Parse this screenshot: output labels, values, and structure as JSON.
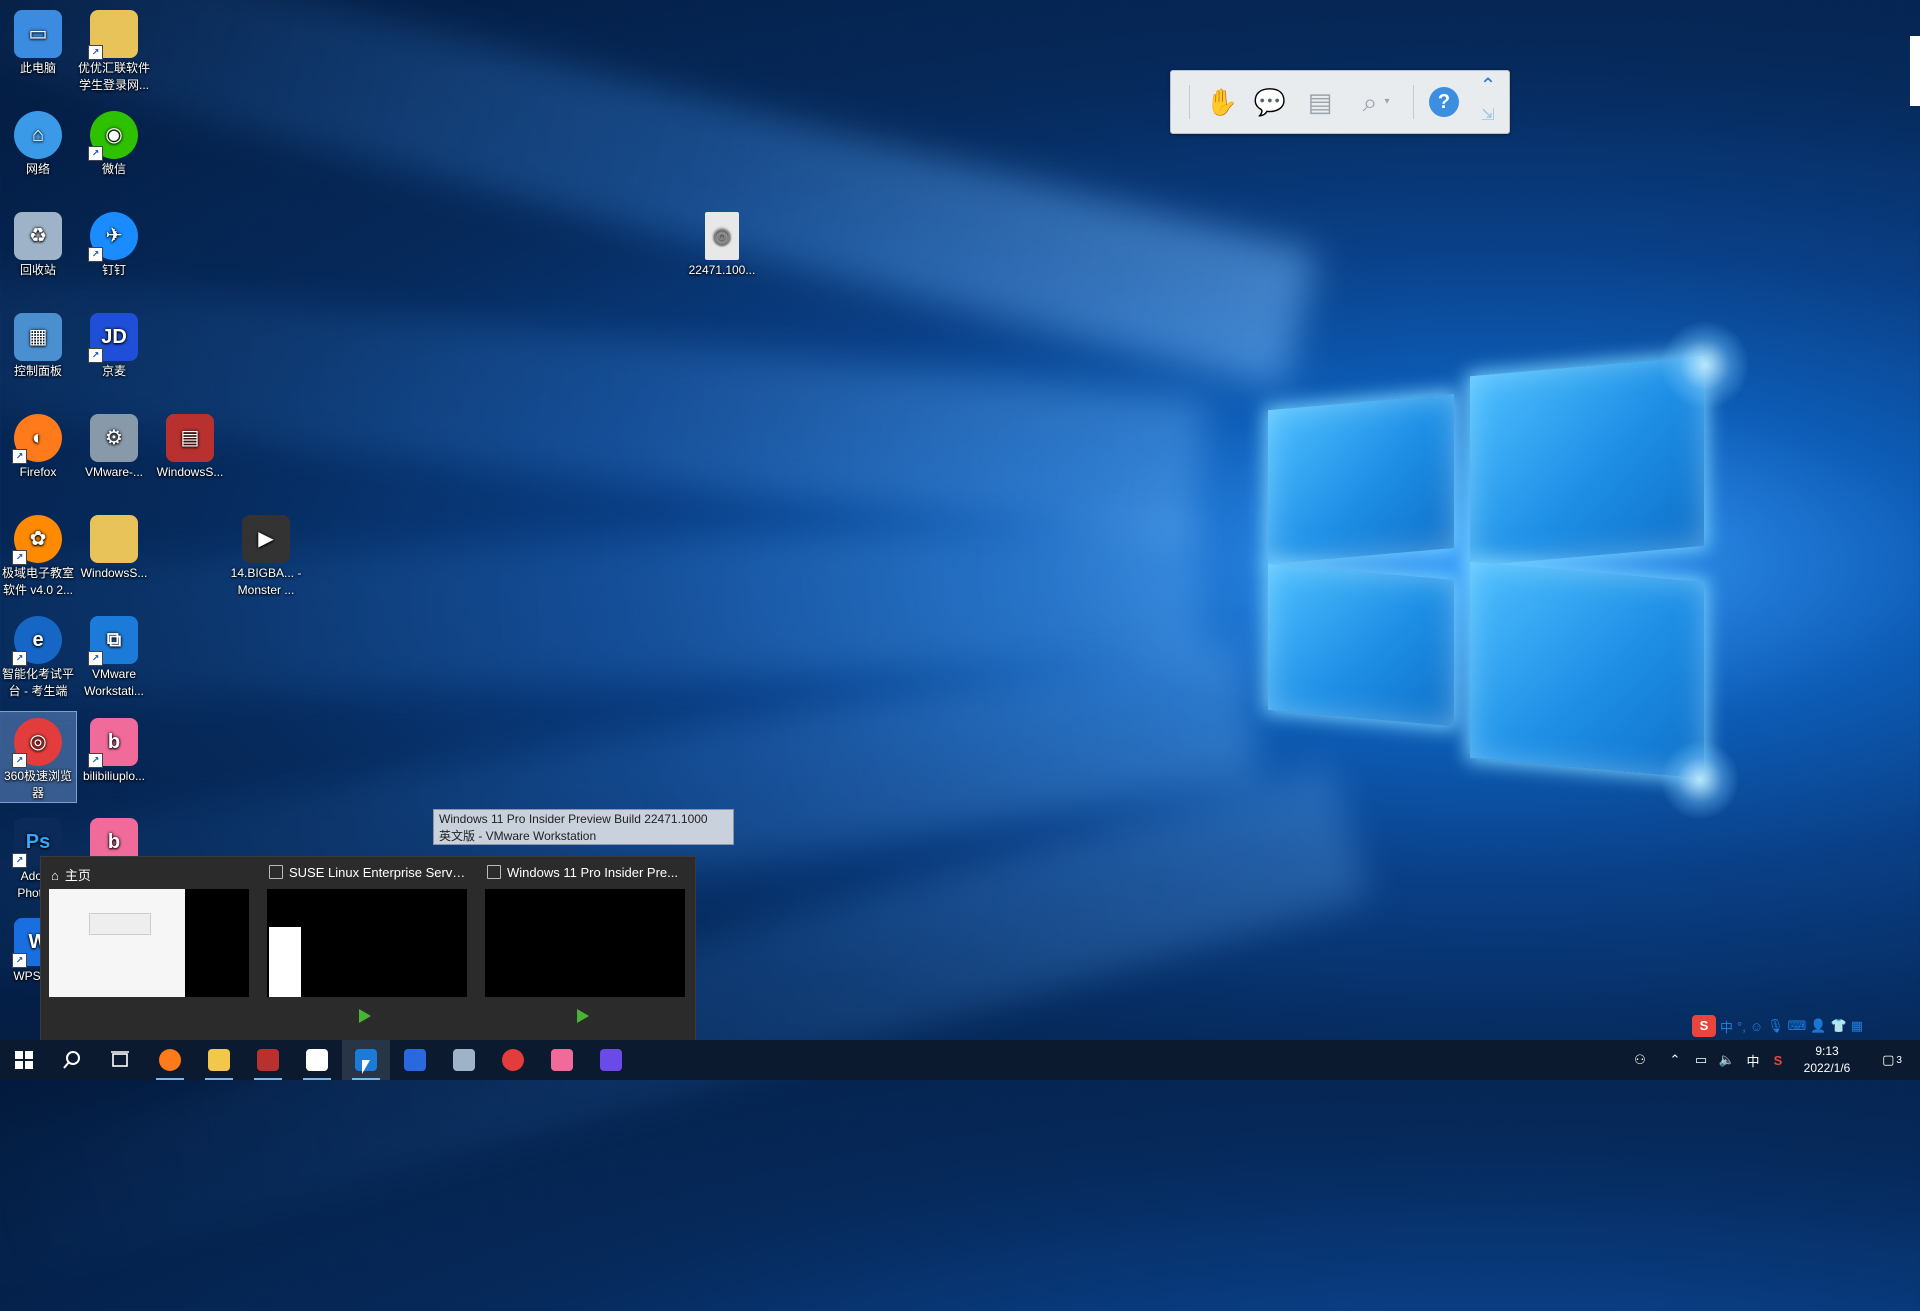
{
  "desktop": {
    "icons": [
      {
        "label": "此电脑",
        "color": "#3b8be0"
      },
      {
        "label": "优优汇联软件学生登录网...",
        "color": "#e8c35a"
      },
      {
        "label": "网络",
        "color": "#3a9ae8"
      },
      {
        "label": "微信",
        "color": "#2dc100"
      },
      {
        "label": "回收站",
        "color": "#9fb3c8"
      },
      {
        "label": "钉钉",
        "color": "#1a8cff"
      },
      {
        "label": "控制面板",
        "color": "#4a8fd0"
      },
      {
        "label": "京麦",
        "color": "#1f4fd8"
      },
      {
        "label": "Firefox",
        "color": "#ff7a1a"
      },
      {
        "label": "VMware-...",
        "color": "#8899aa"
      },
      {
        "label": "WindowsS...",
        "color": "#b8312f"
      },
      {
        "label": "极域电子教室软件 v4.0 2...",
        "color": "#ff8a00"
      },
      {
        "label": "WindowsS...",
        "color": "#e8c35a"
      },
      {
        "label": "14.BIGBA... - Monster ...",
        "color": "#333333"
      },
      {
        "label": "智能化考试平台 - 考生端",
        "color": "#1666c5"
      },
      {
        "label": "VMware Workstati...",
        "color": "#1c7bd8"
      },
      {
        "label": "360极速浏览器",
        "color": "#e23c3c"
      },
      {
        "label": "bilibiliuplo...",
        "color": "#f06a9a"
      },
      {
        "label": "Adobe Photo...",
        "color": "#0b2a5a"
      },
      {
        "label": "bilibili",
        "color": "#f06a9a"
      },
      {
        "label": "WPS C...",
        "color": "#1a6fe0"
      },
      {
        "label": "22471.100...",
        "color": "#e8e8e8"
      }
    ]
  },
  "float_toolbar": {
    "buttons": [
      "hand-tool",
      "comment-tool",
      "stamp-tool",
      "zoom-tool",
      "help"
    ],
    "help_label": "?"
  },
  "vm_tooltip": {
    "line1": "Windows 11 Pro Insider Preview Build 22471.1000",
    "line2": "英文版 - VMware Workstation"
  },
  "task_previews": [
    {
      "title": "主页"
    },
    {
      "title": "SUSE Linux Enterprise Server..."
    },
    {
      "title": "Windows 11 Pro Insider Pre..."
    }
  ],
  "taskbar": {
    "apps": [
      {
        "name": "firefox",
        "color": "#ff7a1a"
      },
      {
        "name": "file-explorer",
        "color": "#f2c84b"
      },
      {
        "name": "winrar",
        "color": "#b8312f"
      },
      {
        "name": "store",
        "color": "#ffffff"
      },
      {
        "name": "vmware",
        "color": "#1c7bd8"
      },
      {
        "name": "wps",
        "color": "#2a68e0"
      },
      {
        "name": "unknown-app",
        "color": "#9fb3c8"
      },
      {
        "name": "360-browser",
        "color": "#e23c3c"
      },
      {
        "name": "bilibili",
        "color": "#f06a9a"
      },
      {
        "name": "video-app",
        "color": "#6b4ae8"
      }
    ],
    "ime_language": "中",
    "time": "9:13",
    "date": "2022/1/6",
    "notification_count": "3"
  },
  "ime_bar": {
    "mode": "中"
  }
}
